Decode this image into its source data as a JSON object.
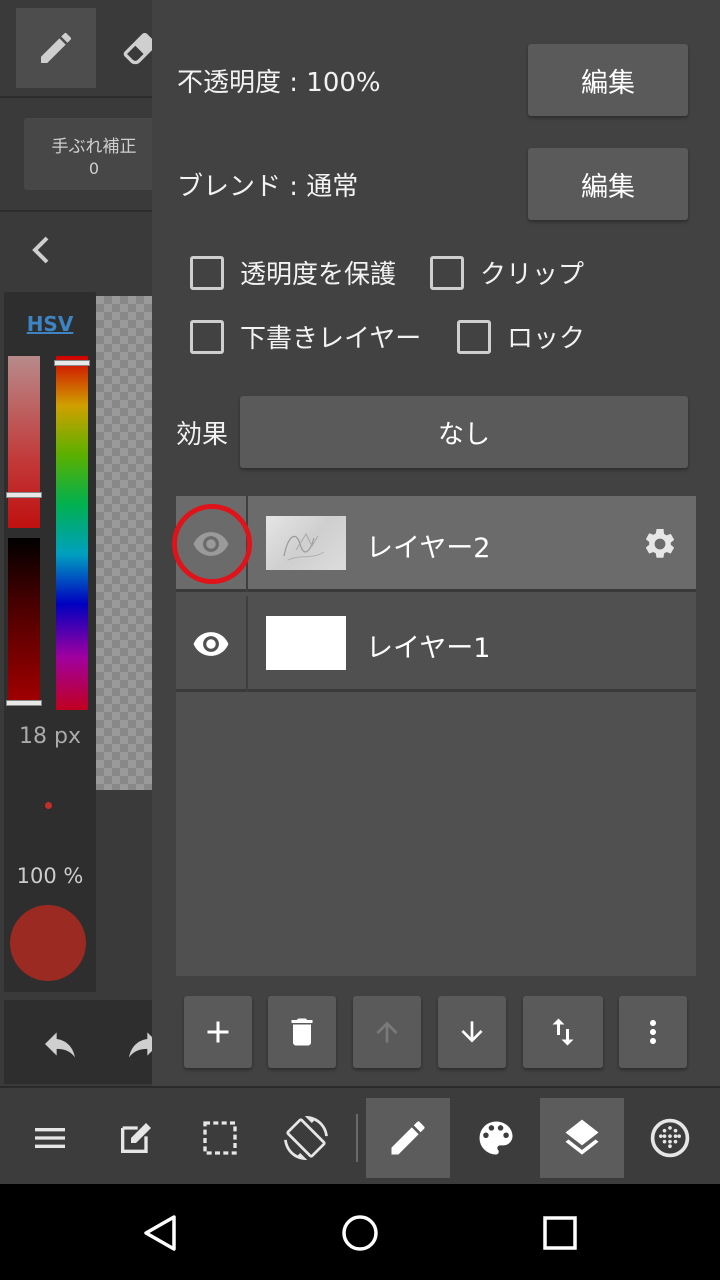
{
  "left_strip": {
    "stabilizer_label": "手ぶれ補正",
    "stabilizer_value": "0",
    "color_mode": "HSV",
    "brush_size": "18 px",
    "brush_opacity": "100 %",
    "current_color": "#9a2a22"
  },
  "panel": {
    "opacity_label": "不透明度 : 100%",
    "opacity_edit": "編集",
    "blend_label": "ブレンド : 通常",
    "blend_edit": "編集",
    "checkboxes": {
      "protect_alpha": "透明度を保護",
      "clipping": "クリップ",
      "draft_layer": "下書きレイヤー",
      "lock": "ロック"
    },
    "effect_label": "効果",
    "effect_value": "なし",
    "layers": [
      {
        "name": "レイヤー2",
        "selected": true,
        "visible": true
      },
      {
        "name": "レイヤー1",
        "selected": false,
        "visible": true
      }
    ]
  },
  "layer_tools": [
    "plus-icon",
    "trash-icon",
    "arrow-up-icon",
    "arrow-down-icon",
    "swap-vertical-icon",
    "more-vertical-icon"
  ],
  "toolbar": [
    "menu-icon",
    "edit-box-icon",
    "selection-icon",
    "rotate-screen-icon",
    "brush-icon",
    "palette-icon",
    "layers-icon",
    "materials-icon"
  ],
  "colors": {
    "panel_bg": "#424242",
    "button_bg": "#5a5a5a",
    "selected_row": "#6b6b6b",
    "highlight_ring": "#e0121a",
    "hsv_link": "#3c84c4"
  }
}
